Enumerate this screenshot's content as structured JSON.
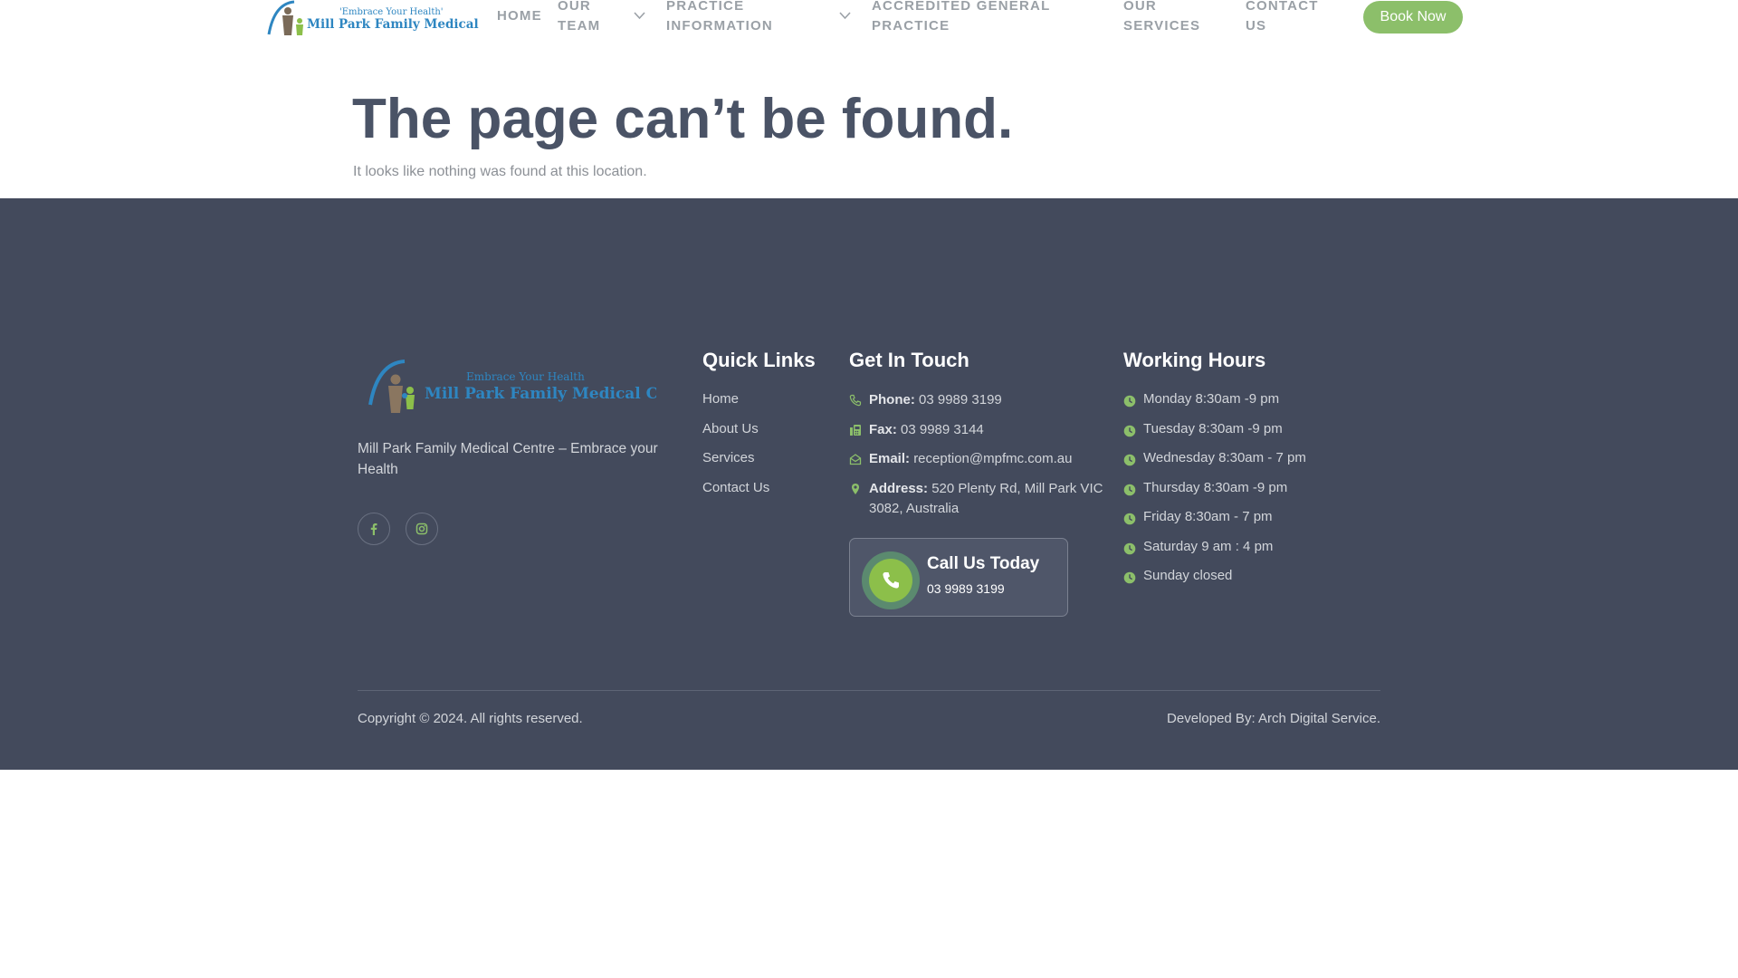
{
  "header": {
    "logo_tagline": "'Embrace Your Health'",
    "logo_name": "Mill Park Family Medical Centre",
    "nav": [
      {
        "label": "HOME"
      },
      {
        "label": "OUR TEAM"
      },
      {
        "label": "PRACTICE INFORMATION"
      },
      {
        "label": "ACCREDITED GENERAL PRACTICE"
      },
      {
        "label": "OUR SERVICES"
      },
      {
        "label": "CONTACT US"
      }
    ],
    "book_label": "Book Now"
  },
  "main": {
    "title": "The page can’t be found.",
    "subtitle": "It looks like nothing was found at this location."
  },
  "footer": {
    "logo_tagline": "Embrace Your Health",
    "logo_name": "Mill Park Family Medical Centre",
    "tagline": "Mill Park Family Medical Centre – Embrace your Health",
    "quick_links": {
      "heading": "Quick Links",
      "items": [
        "Home",
        "About Us",
        "Services",
        "Contact Us"
      ]
    },
    "contact": {
      "heading": "Get In Touch",
      "phone_label": "Phone:",
      "phone": "03 9989 3199",
      "fax_label": "Fax:",
      "fax": "03 9989 3144",
      "email_label": "Email:",
      "email": "reception@mpfmc.com.au",
      "address_label": "Address:",
      "address": "520 Plenty Rd, Mill Park VIC 3082, Australia"
    },
    "call_card": {
      "title": "Call Us Today",
      "number": "03 9989 3199"
    },
    "hours": {
      "heading": "Working Hours",
      "items": [
        "Monday 8:30am -9 pm",
        "Tuesday 8:30am -9 pm",
        "Wednesday 8:30am - 7 pm",
        "Thursday 8:30am -9 pm",
        "Friday 8:30am - 7 pm",
        "Saturday 9 am : 4 pm",
        "Sunday  closed"
      ]
    },
    "copyright": "Copyright © 2024. All rights reserved.",
    "developer": "Developed By: Arch Digital Service."
  },
  "colors": {
    "accent_green": "#8cbf6a",
    "footer_bg": "#434a5c",
    "title": "#4a5366"
  },
  "icons": [
    "chevron-down-icon",
    "phone-icon",
    "fax-icon",
    "email-icon",
    "location-icon",
    "clock-icon",
    "facebook-icon",
    "instagram-icon"
  ]
}
